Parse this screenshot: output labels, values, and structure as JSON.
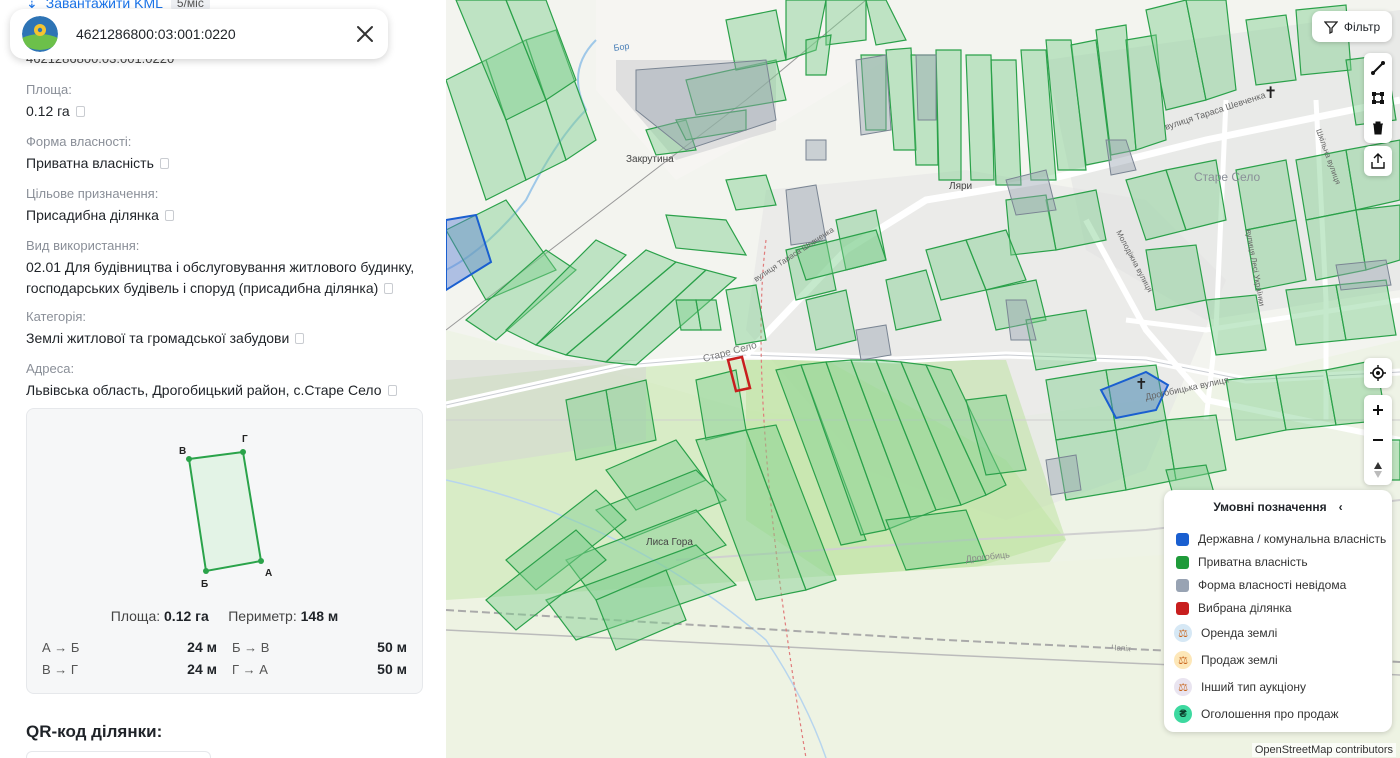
{
  "panel": {
    "kml_link": "Завантажити KML",
    "kml_badge": "5/міс",
    "search_query": "4621286800:03:001:0220",
    "peek_id": "4621286800:03:001:0220",
    "fields": [
      {
        "label": "Площа:",
        "value": "0.12 га"
      },
      {
        "label": "Форма власності:",
        "value": "Приватна власність"
      },
      {
        "label": "Цільове призначення:",
        "value": "Присадибна ділянка"
      },
      {
        "label": "Вид використання:",
        "value": "02.01 Для будівництва і обслуговування житлового будинку, господарських будівель і споруд (присадибна ділянка)"
      },
      {
        "label": "Категорія:",
        "value": "Землі житлової та громадської забудови"
      },
      {
        "label": "Адреса:",
        "value": "Львівська область, Дрогобицький район, с.Старе Село"
      }
    ],
    "shape": {
      "vertices": [
        "В",
        "Г",
        "Б",
        "А"
      ],
      "area_label": "Площа:",
      "area_value": "0.12 га",
      "perimeter_label": "Периметр:",
      "perimeter_value": "148 м",
      "sides": [
        {
          "name": "А → Б",
          "length": "24 м"
        },
        {
          "name": "Б → В",
          "length": "50 м"
        },
        {
          "name": "В → Г",
          "length": "24 м"
        },
        {
          "name": "Г → А",
          "length": "50 м"
        }
      ]
    },
    "qr_title": "QR-код ділянки:"
  },
  "map": {
    "filter_label": "Фільтр",
    "place_labels": [
      "Закрутина",
      "Ляри",
      "Старе Село",
      "Лиса Гора",
      "Бор",
      "Старе Село",
      "Дрогобицька вулиця",
      "Дрогобиць",
      "вулиця Тараса Шевченка",
      "вулиця Тараса Шевченка",
      "Молодіжна вулиця",
      "вулиця Лесі Українки",
      "Шкільна вулиця",
      "Чапік"
    ],
    "legend": {
      "title": "Умовні позначення",
      "items": [
        {
          "label": "Державна / комунальна власність",
          "color": "#1a5fd0"
        },
        {
          "label": "Приватна власність",
          "color": "#1f9b3a"
        },
        {
          "label": "Форма власності невідома",
          "color": "#98a3b3"
        },
        {
          "label": "Вибрана ділянка",
          "color": "#c81e1e"
        }
      ],
      "auctions": [
        {
          "label": "Оренда землі",
          "color": "#d6e8f5"
        },
        {
          "label": "Продаж землі",
          "color": "#fde7b8"
        },
        {
          "label": "Інший тип аукціону",
          "color": "#e9e4f0"
        },
        {
          "label": "Оголошення про продаж",
          "color": "#3dd9a0",
          "glyph": "₴"
        }
      ]
    },
    "attribution": "OpenStreetMap contributors"
  }
}
